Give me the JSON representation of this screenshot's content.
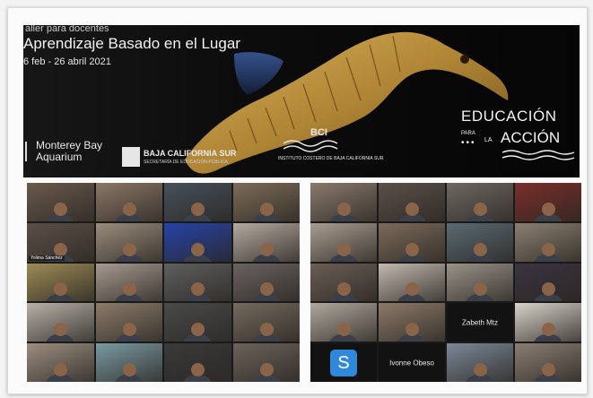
{
  "banner": {
    "topline": "aller para docentes",
    "title": "Aprendizaje Basado en el Lugar",
    "dates": "6 feb - 26 abril 2021",
    "logos": {
      "monterey_line1": "Monterey Bay",
      "monterey_line2": "Aquarium",
      "bcs_line1": "BAJA CALIFORNIA SUR",
      "bcs_line2": "SECRETARÍA DE EDUCACIÓN PÚBLICA",
      "bci_name": "BCI",
      "bci_sub": "INSTITUTO COSTERO DE BAJA CALIFORNIA SUR",
      "edu_line1": "EDUCACIÓN",
      "edu_para": "PARA",
      "edu_la": "LA",
      "edu_accion": "ACCIÓN"
    }
  },
  "participants": {
    "left": [
      {
        "type": "video",
        "bg": "#6a5a4c"
      },
      {
        "type": "video",
        "bg": "#8b7766"
      },
      {
        "type": "video",
        "bg": "#46505a"
      },
      {
        "type": "video",
        "bg": "#7c6c58"
      },
      {
        "type": "video",
        "bg": "#5c5048",
        "tag": "Yolima Sánchez"
      },
      {
        "type": "video",
        "bg": "#9a8c7c"
      },
      {
        "type": "video",
        "bg": "#2643a8"
      },
      {
        "type": "video",
        "bg": "#b4aaa0"
      },
      {
        "type": "video",
        "bg": "#9c8a56"
      },
      {
        "type": "video",
        "bg": "#a69a90"
      },
      {
        "type": "video",
        "bg": "#5f5f5f"
      },
      {
        "type": "video",
        "bg": "#6a6260"
      },
      {
        "type": "video",
        "bg": "#b8b0a8"
      },
      {
        "type": "video",
        "bg": "#8c7c6a"
      },
      {
        "type": "video",
        "bg": "#4a4a4a"
      },
      {
        "type": "video",
        "bg": "#746a5e"
      },
      {
        "type": "video",
        "bg": "#9c8e80"
      },
      {
        "type": "video",
        "bg": "#7a9aa2"
      },
      {
        "type": "video",
        "bg": "#3a3a3a"
      },
      {
        "type": "video",
        "bg": "#6c625a"
      }
    ],
    "right": [
      {
        "type": "video",
        "bg": "#8a7a6c"
      },
      {
        "type": "video",
        "bg": "#5a5048"
      },
      {
        "type": "video",
        "bg": "#6e6862"
      },
      {
        "type": "video",
        "bg": "#7a2e2a"
      },
      {
        "type": "video",
        "bg": "#a89c90"
      },
      {
        "type": "video",
        "bg": "#7c6a5a"
      },
      {
        "type": "video",
        "bg": "#5a6a72"
      },
      {
        "type": "video",
        "bg": "#8a8070"
      },
      {
        "type": "video",
        "bg": "#6a5e56"
      },
      {
        "type": "video",
        "bg": "#c2b8ae"
      },
      {
        "type": "video",
        "bg": "#9a9288"
      },
      {
        "type": "video",
        "bg": "#3a3440"
      },
      {
        "type": "video",
        "bg": "#b0a89e"
      },
      {
        "type": "video",
        "bg": "#8c7a68"
      },
      {
        "type": "name",
        "name": "Zabeth Mtz"
      },
      {
        "type": "video",
        "bg": "#d8d2ca"
      },
      {
        "type": "avatar",
        "letter": "S"
      },
      {
        "type": "name",
        "name": "Ivonne Obeso"
      },
      {
        "type": "video",
        "bg": "#7a8896"
      },
      {
        "type": "video",
        "bg": "#8a7e72"
      }
    ]
  },
  "colors": {
    "banner_bg": "#0c0c0c",
    "seahorse": "#b8903a",
    "avatar_blue": "#2f88d8"
  }
}
